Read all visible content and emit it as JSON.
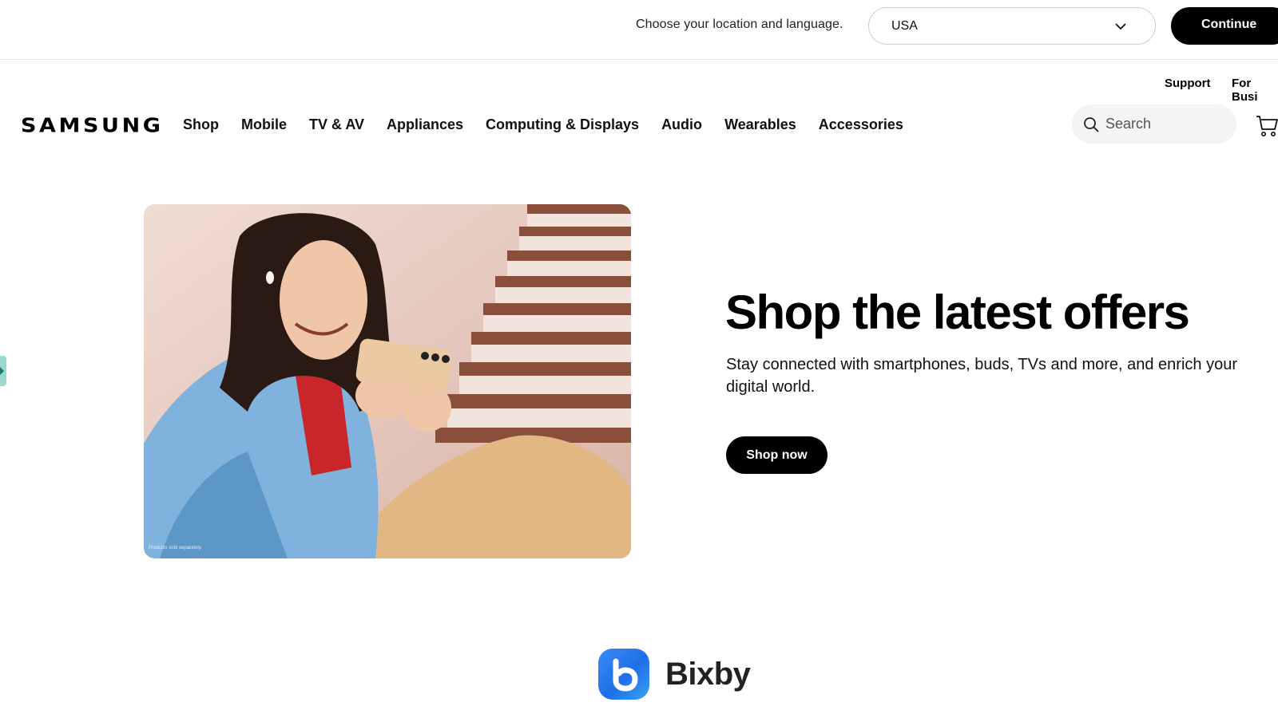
{
  "location_bar": {
    "prompt": "Choose your location and language.",
    "selected_country": "USA",
    "continue_label": "Continue"
  },
  "utility_nav": {
    "support": "Support",
    "for_business": "For Busi"
  },
  "header": {
    "logo": "SAMSUNG",
    "nav": [
      "Shop",
      "Mobile",
      "TV & AV",
      "Appliances",
      "Computing & Displays",
      "Audio",
      "Wearables",
      "Accessories"
    ],
    "search_placeholder": "Search"
  },
  "hero": {
    "title": "Shop the latest offers",
    "subtitle": "Stay connected with smartphones, buds, TVs and more, and enrich your digital world.",
    "cta": "Shop now",
    "image_fineprint": "Products sold separately."
  },
  "bixby": {
    "label": "Bixby"
  },
  "icons": [
    "chevron-down-icon",
    "search-icon",
    "cart-icon",
    "arrow-right-icon",
    "bixby-icon"
  ],
  "colors": {
    "primary_button": "#000000",
    "button_text": "#ffffff",
    "search_bg": "#f4f4f4",
    "edge_tab": "#9ad7cf",
    "bixby_blue": "#1f6ee8"
  }
}
